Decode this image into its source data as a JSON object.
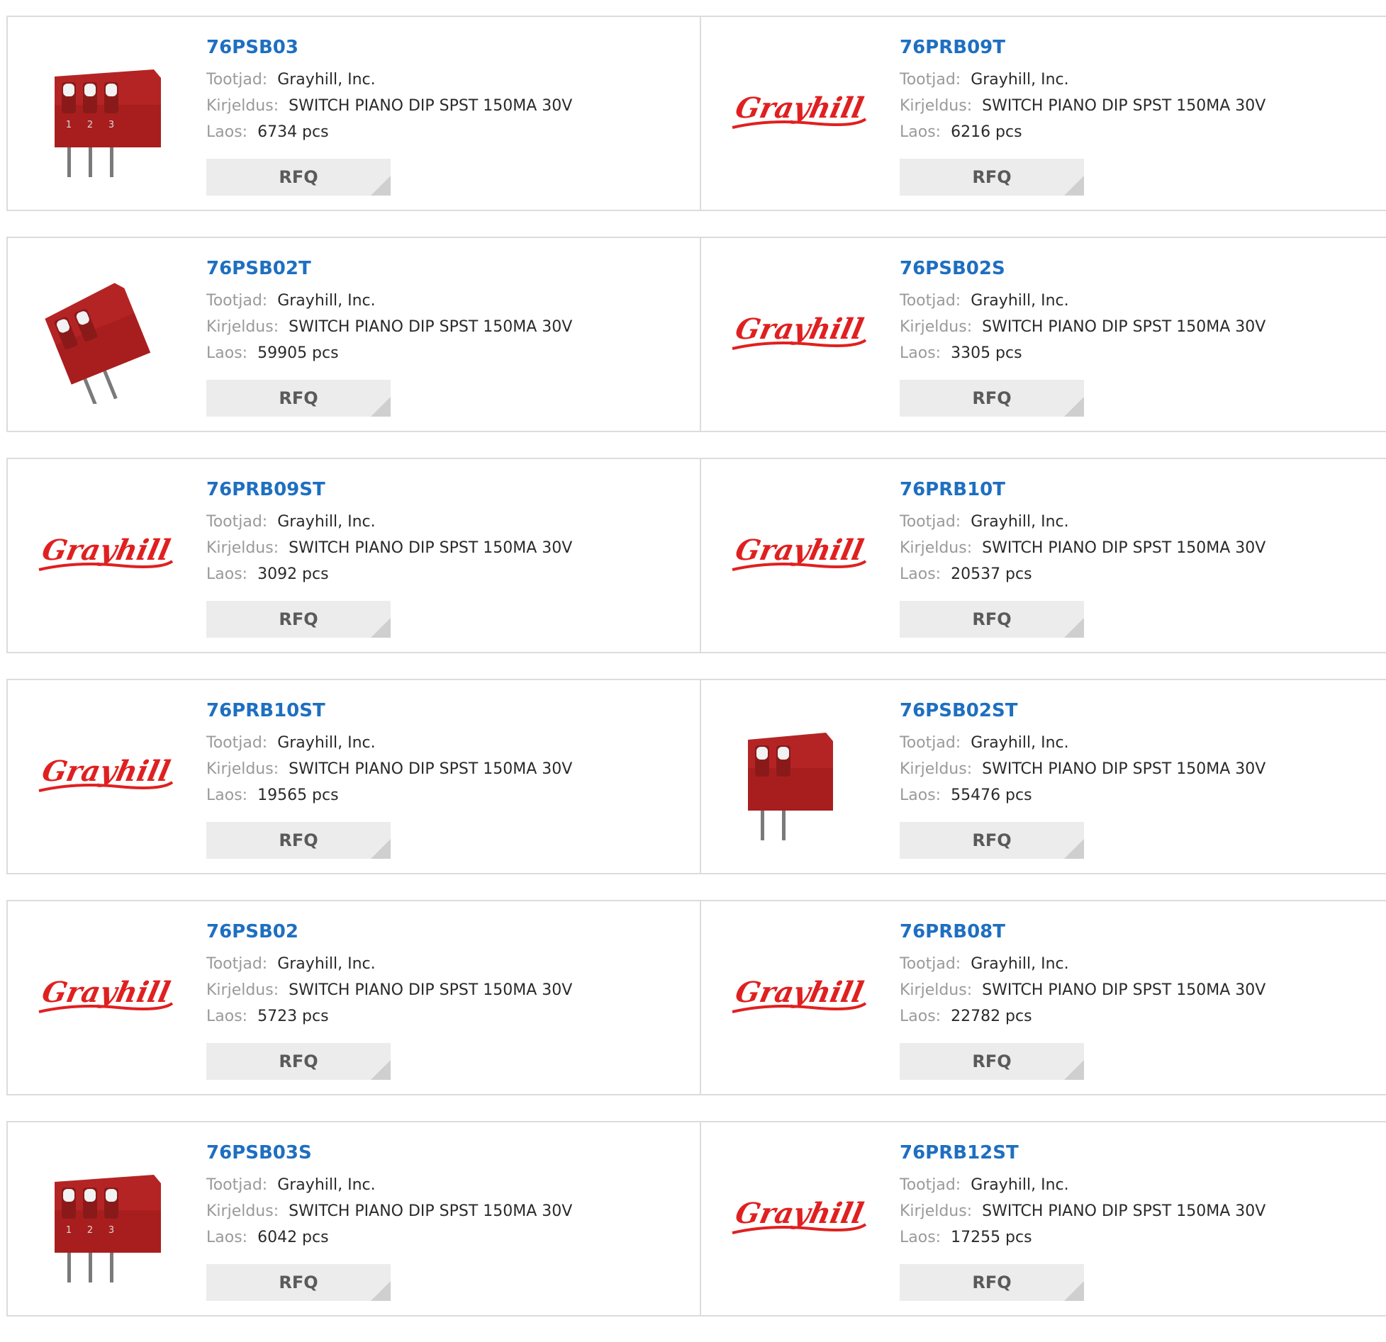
{
  "labels": {
    "manufacturer": "Tootjad:",
    "description": "Kirjeldus:",
    "stock": "Laos:",
    "rfq": "RFQ"
  },
  "logo_text": "Grayhill",
  "products": [
    {
      "part": "76PSB03",
      "manufacturer": "Grayhill, Inc.",
      "description": "SWITCH PIANO DIP SPST 150MA 30V",
      "stock": "6734 pcs",
      "image": "dip-switch-3pos"
    },
    {
      "part": "76PRB09T",
      "manufacturer": "Grayhill, Inc.",
      "description": "SWITCH PIANO DIP SPST 150MA 30V",
      "stock": "6216 pcs",
      "image": "grayhill-logo"
    },
    {
      "part": "76PSB02T",
      "manufacturer": "Grayhill, Inc.",
      "description": "SWITCH PIANO DIP SPST 150MA 30V",
      "stock": "59905 pcs",
      "image": "dip-switch-2pos-angled"
    },
    {
      "part": "76PSB02S",
      "manufacturer": "Grayhill, Inc.",
      "description": "SWITCH PIANO DIP SPST 150MA 30V",
      "stock": "3305 pcs",
      "image": "grayhill-logo"
    },
    {
      "part": "76PRB09ST",
      "manufacturer": "Grayhill, Inc.",
      "description": "SWITCH PIANO DIP SPST 150MA 30V",
      "stock": "3092 pcs",
      "image": "grayhill-logo"
    },
    {
      "part": "76PRB10T",
      "manufacturer": "Grayhill, Inc.",
      "description": "SWITCH PIANO DIP SPST 150MA 30V",
      "stock": "20537 pcs",
      "image": "grayhill-logo"
    },
    {
      "part": "76PRB10ST",
      "manufacturer": "Grayhill, Inc.",
      "description": "SWITCH PIANO DIP SPST 150MA 30V",
      "stock": "19565 pcs",
      "image": "grayhill-logo"
    },
    {
      "part": "76PSB02ST",
      "manufacturer": "Grayhill, Inc.",
      "description": "SWITCH PIANO DIP SPST 150MA 30V",
      "stock": "55476 pcs",
      "image": "dip-switch-2pos"
    },
    {
      "part": "76PSB02",
      "manufacturer": "Grayhill, Inc.",
      "description": "SWITCH PIANO DIP SPST 150MA 30V",
      "stock": "5723 pcs",
      "image": "grayhill-logo"
    },
    {
      "part": "76PRB08T",
      "manufacturer": "Grayhill, Inc.",
      "description": "SWITCH PIANO DIP SPST 150MA 30V",
      "stock": "22782 pcs",
      "image": "grayhill-logo"
    },
    {
      "part": "76PSB03S",
      "manufacturer": "Grayhill, Inc.",
      "description": "SWITCH PIANO DIP SPST 150MA 30V",
      "stock": "6042 pcs",
      "image": "dip-switch-3pos"
    },
    {
      "part": "76PRB12ST",
      "manufacturer": "Grayhill, Inc.",
      "description": "SWITCH PIANO DIP SPST 150MA 30V",
      "stock": "17255 pcs",
      "image": "grayhill-logo"
    }
  ]
}
